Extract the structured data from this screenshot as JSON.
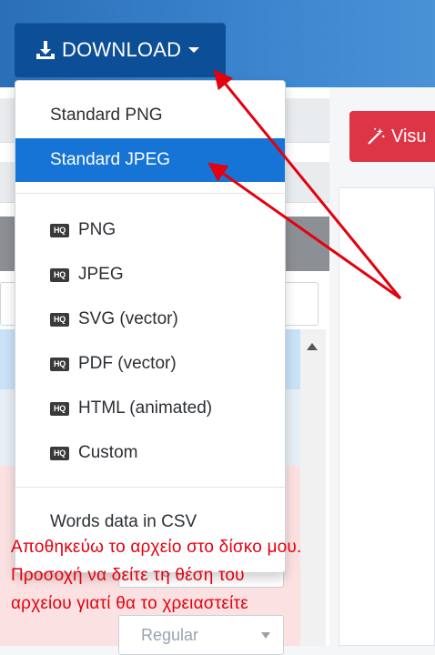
{
  "toolbar": {
    "download_label": "DOWNLOAD",
    "download_icon": "download-icon",
    "visualize_label": "Visu",
    "visualize_icon": "magic-wand-icon"
  },
  "download_menu": {
    "standard_items": [
      {
        "label": "Standard PNG",
        "active": false
      },
      {
        "label": "Standard JPEG",
        "active": true
      }
    ],
    "hq_badge": "HQ",
    "hq_items": [
      {
        "label": "PNG"
      },
      {
        "label": "JPEG"
      },
      {
        "label": "SVG (vector)"
      },
      {
        "label": "PDF (vector)"
      },
      {
        "label": "HTML (animated)"
      },
      {
        "label": "Custom"
      }
    ],
    "data_items": [
      {
        "label": "Words data in CSV"
      }
    ]
  },
  "font_weight_selects": [
    {
      "value": "Regular"
    },
    {
      "value": "Regular"
    }
  ],
  "annotation": {
    "lines": [
      "Αποθηκεύω το αρχείο στο δίσκο μου.",
      "Προσοχή να δείτε τη θέση του",
      "αρχείου γιατί θα το χρειαστείτε"
    ],
    "color": "#e3000f"
  },
  "colors": {
    "download_button": "#0d4f96",
    "active_item": "#1674d6",
    "visualize_button": "#dc3545",
    "arrow": "#e3000f"
  }
}
